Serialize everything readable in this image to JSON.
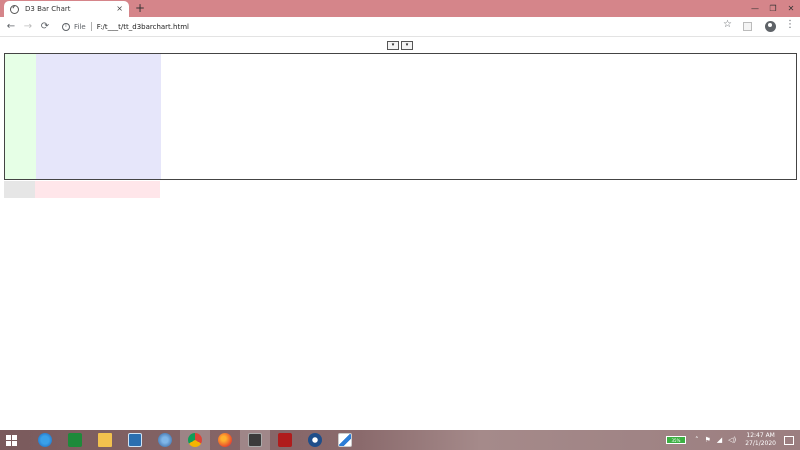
{
  "browser": {
    "tab_title": "D3 Bar Chart",
    "tab_close": "×",
    "new_tab": "+",
    "window_controls": {
      "minimize": "—",
      "maximize": "❐",
      "close": "✕"
    },
    "nav": {
      "back": "←",
      "forward": "→",
      "reload": "⟳"
    },
    "omnibox": {
      "info": "i",
      "scheme": "File",
      "url": "F:/t___t/tt_d3barchart.html"
    },
    "star": "☆",
    "menu": "⋮"
  },
  "page": {
    "dropdowns": [
      {
        "selected": "▾"
      },
      {
        "selected": "▾"
      }
    ],
    "colors": {
      "y_axis_area": "#e6ffe6",
      "plot_area": "#e6e6fa",
      "corner_area": "#e6e6e6",
      "x_axis_area": "#ffe6ea",
      "frame_border": "#444444"
    }
  },
  "taskbar": {
    "icons": [
      "windows-logo",
      "internet-explorer-icon",
      "store-icon",
      "file-explorer-icon",
      "remote-desktop-icon",
      "globe-icon",
      "chrome-icon",
      "firefox-icon",
      "sublime-text-icon",
      "filezilla-icon",
      "settings-icon",
      "pen-icon"
    ],
    "battery": "35%",
    "tray": {
      "flag": "⚑",
      "chevron": "˄",
      "volume": "◁)",
      "wifi": "◢"
    },
    "time": "12:47 AM",
    "date": "27/1/2020"
  }
}
